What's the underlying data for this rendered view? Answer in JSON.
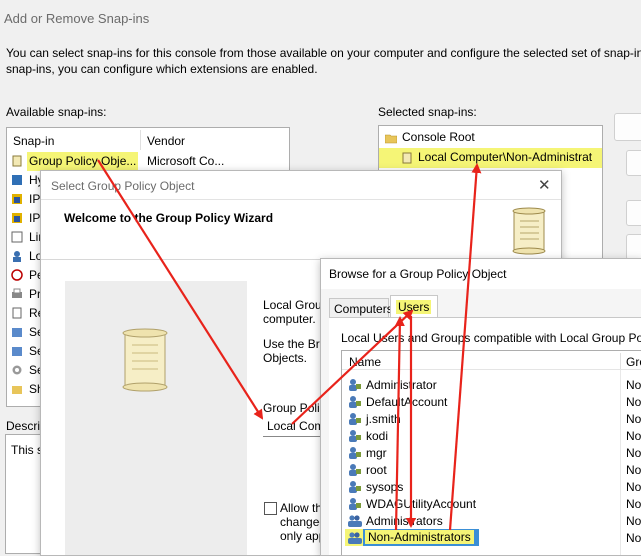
{
  "main": {
    "title": "Add or Remove Snap-ins",
    "description_line1": "You can select snap-ins for this console from those available on your computer and configure the selected set of snap-in",
    "description_line2": "snap-ins, you can configure which extensions are enabled.",
    "available_label": "Available snap-ins:",
    "selected_label": "Selected snap-ins:",
    "col_snapin": "Snap-in",
    "col_vendor": "Vendor",
    "available_items": [
      {
        "label": "Group Policy Obje...",
        "vendor": "Microsoft Co..."
      },
      {
        "label": "Hy"
      },
      {
        "label": "IP"
      },
      {
        "label": "IP"
      },
      {
        "label": "Lin"
      },
      {
        "label": "Lo"
      },
      {
        "label": "Pe"
      },
      {
        "label": "Pri"
      },
      {
        "label": "Re"
      },
      {
        "label": "Se"
      },
      {
        "label": "Se"
      },
      {
        "label": "Se"
      },
      {
        "label": "Sh"
      }
    ],
    "selected_items": [
      {
        "label": "Console Root"
      },
      {
        "label": "Local Computer\\Non-Administrat"
      }
    ],
    "description_heading": "Descrip",
    "description_text": "This s"
  },
  "wizard": {
    "title": "Select Group Policy Object",
    "close_glyph": "✕",
    "heading": "Welcome to the Group Policy Wizard",
    "text1a": "Local Group",
    "text1b": "computer.",
    "text2a": "Use the Brov",
    "text2b": "Objects.",
    "gpo_label": "Group Policy",
    "gpo_value": "Local Compu",
    "allow_a": "Allow the",
    "allow_b": "changed",
    "allow_c": "only appl"
  },
  "browse": {
    "title": "Browse for a Group Policy Object",
    "tabs": [
      "Computers",
      "Users"
    ],
    "caption": "Local Users and Groups compatible with Local Group Policy:",
    "col_name": "Name",
    "col_group": "Gro",
    "rows": [
      {
        "name": "Administrator",
        "val": "No"
      },
      {
        "name": "DefaultAccount",
        "val": "No"
      },
      {
        "name": "j.smith",
        "val": "No"
      },
      {
        "name": "kodi",
        "val": "No"
      },
      {
        "name": "mgr",
        "val": "No"
      },
      {
        "name": "root",
        "val": "No"
      },
      {
        "name": "sysops",
        "val": "No"
      },
      {
        "name": "WDAGUtilityAccount",
        "val": "No"
      },
      {
        "name": "Administrators",
        "val": "No"
      },
      {
        "name": "Non-Administrators",
        "val": "No"
      }
    ]
  },
  "colors": {
    "highlight": "#f5f576",
    "arrow": "#e8231b",
    "selection": "#3b8fd6"
  }
}
